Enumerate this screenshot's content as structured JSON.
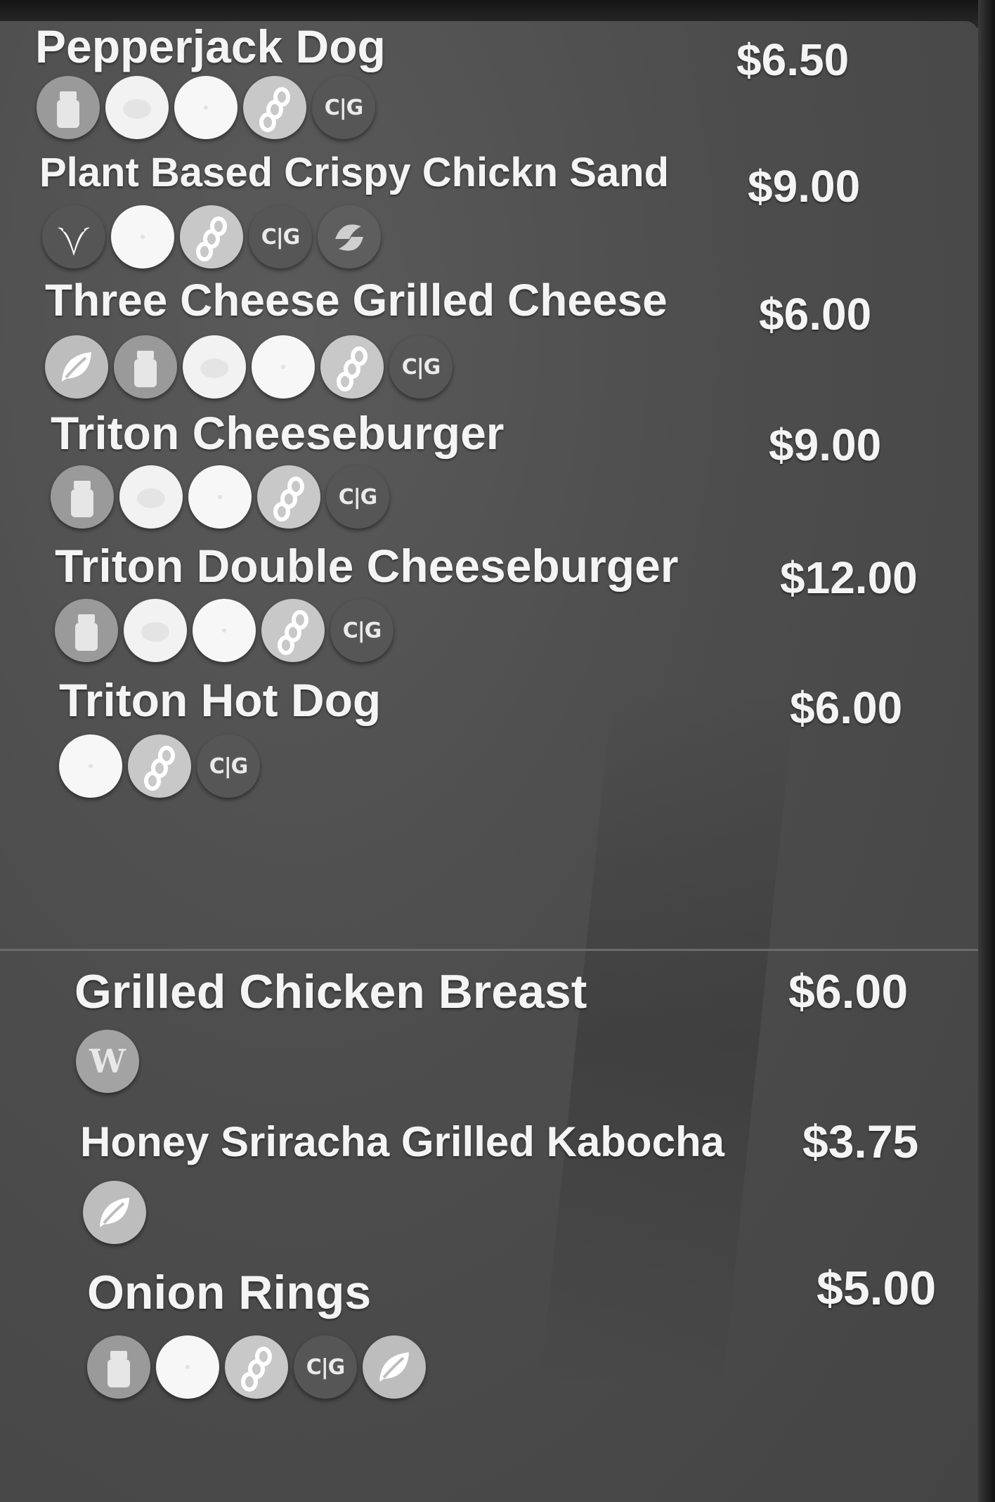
{
  "menu": {
    "items": [
      {
        "name": "Pepperjack Dog",
        "price": "$6.50",
        "icons": [
          "dairy-icon",
          "egg-icon",
          "wheat-icon",
          "soy-icon",
          "cig-icon"
        ]
      },
      {
        "name": "Plant Based Crispy Chickn Sand",
        "price": "$9.00",
        "icons": [
          "vegan-icon",
          "wheat-icon",
          "soy-icon",
          "cig-icon",
          "sesame-icon"
        ]
      },
      {
        "name": "Three Cheese Grilled Cheese",
        "price": "$6.00",
        "icons": [
          "vegetarian-icon",
          "dairy-icon",
          "egg-icon",
          "wheat-icon",
          "soy-icon",
          "cig-icon"
        ]
      },
      {
        "name": "Triton Cheeseburger",
        "price": "$9.00",
        "icons": [
          "dairy-icon",
          "egg-icon",
          "wheat-icon",
          "soy-icon",
          "cig-icon"
        ]
      },
      {
        "name": "Triton Double Cheeseburger",
        "price": "$12.00",
        "icons": [
          "dairy-icon",
          "egg-icon",
          "wheat-icon",
          "soy-icon",
          "cig-icon"
        ]
      },
      {
        "name": "Triton Hot Dog",
        "price": "$6.00",
        "icons": [
          "wheat-icon",
          "soy-icon",
          "cig-icon"
        ]
      },
      {
        "name": "Grilled Chicken Breast",
        "price": "$6.00",
        "icons": [
          "wellness-icon"
        ]
      },
      {
        "name": "Honey Sriracha Grilled Kabocha",
        "price": "$3.75",
        "icons": [
          "vegetarian-icon"
        ]
      },
      {
        "name": "Onion Rings",
        "price": "$5.00",
        "icons": [
          "dairy-icon",
          "wheat-icon",
          "soy-icon",
          "cig-icon",
          "vegetarian-icon"
        ]
      }
    ]
  },
  "icon_glyphs": {
    "cig": "C|G",
    "wellness": "W"
  }
}
